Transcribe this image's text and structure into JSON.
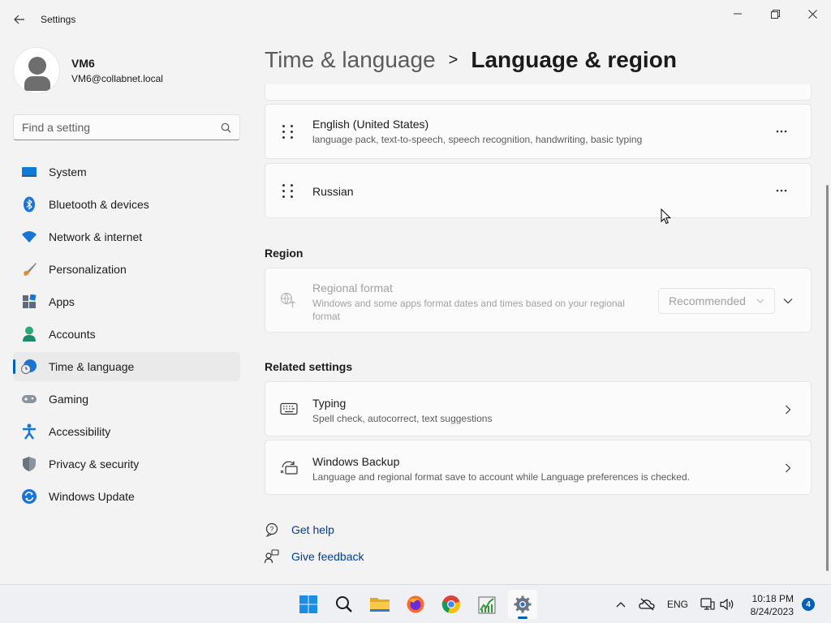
{
  "window": {
    "title": "Settings",
    "back_icon": "arrow-left-icon",
    "controls": [
      "minimize-icon",
      "restore-icon",
      "close-icon"
    ]
  },
  "profile": {
    "name": "VM6",
    "email": "VM6@collabnet.local"
  },
  "search": {
    "placeholder": "Find a setting",
    "value": ""
  },
  "sidebar": {
    "items": [
      {
        "label": "System",
        "icon": "system-icon",
        "active": false
      },
      {
        "label": "Bluetooth & devices",
        "icon": "bluetooth-icon",
        "active": false
      },
      {
        "label": "Network & internet",
        "icon": "wifi-icon",
        "active": false
      },
      {
        "label": "Personalization",
        "icon": "paintbrush-icon",
        "active": false
      },
      {
        "label": "Apps",
        "icon": "apps-icon",
        "active": false
      },
      {
        "label": "Accounts",
        "icon": "account-icon",
        "active": false
      },
      {
        "label": "Time & language",
        "icon": "clock-globe-icon",
        "active": true
      },
      {
        "label": "Gaming",
        "icon": "gamepad-icon",
        "active": false
      },
      {
        "label": "Accessibility",
        "icon": "accessibility-icon",
        "active": false
      },
      {
        "label": "Privacy & security",
        "icon": "shield-icon",
        "active": false
      },
      {
        "label": "Windows Update",
        "icon": "update-icon",
        "active": false
      }
    ]
  },
  "breadcrumb": {
    "parent": "Time & language",
    "separator": ">",
    "current": "Language & region"
  },
  "languages": [
    {
      "name": "English (United States)",
      "features": "language pack, text-to-speech, speech recognition, handwriting, basic typing"
    },
    {
      "name": "Russian",
      "features": ""
    }
  ],
  "region": {
    "heading": "Region",
    "regional_format": {
      "title": "Regional format",
      "description": "Windows and some apps format dates and times based on your regional format",
      "selected": "Recommended",
      "enabled": false
    }
  },
  "related": {
    "heading": "Related settings",
    "items": [
      {
        "title": "Typing",
        "description": "Spell check, autocorrect, text suggestions",
        "icon": "keyboard-icon"
      },
      {
        "title": "Windows Backup",
        "description": "Language and regional format save to account while Language preferences is checked.",
        "icon": "backup-sync-icon"
      }
    ]
  },
  "help_links": {
    "get_help": "Get help",
    "give_feedback": "Give feedback"
  },
  "taskbar": {
    "apps": [
      "start-icon",
      "search-icon",
      "file-explorer-icon",
      "firefox-icon",
      "chrome-icon",
      "taskmgr-icon",
      "settings-icon"
    ],
    "tray": {
      "language": "ENG",
      "time": "10:18 PM",
      "date": "8/24/2023",
      "notifications": "4"
    }
  },
  "colors": {
    "accent": "#005fb8",
    "link": "#003e92",
    "background": "#f3f3f3",
    "card": "#fbfbfb"
  }
}
